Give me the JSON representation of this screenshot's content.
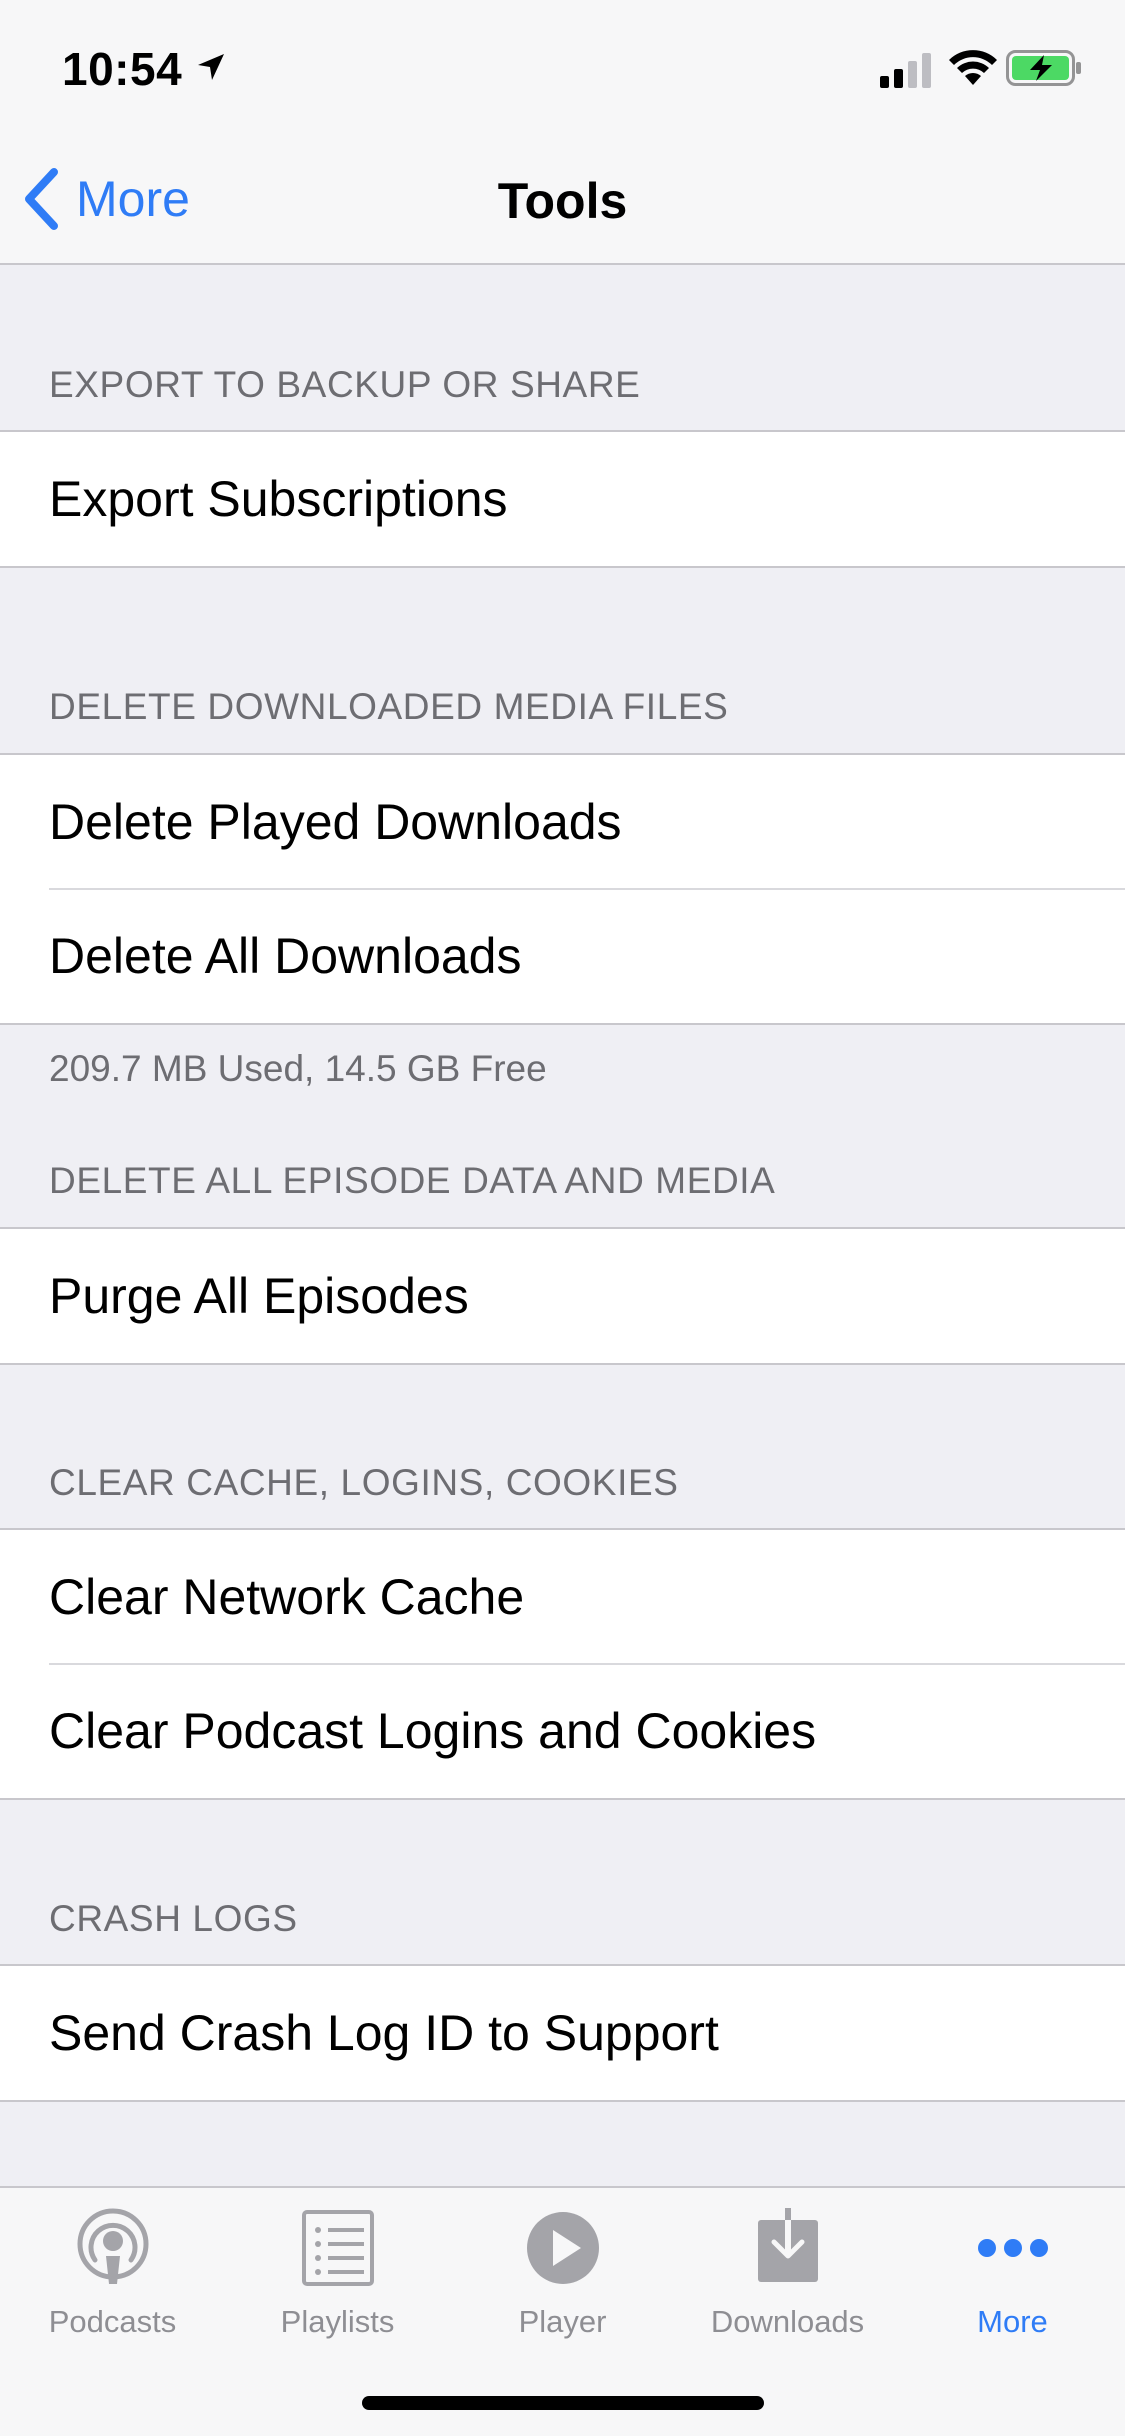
{
  "status_bar": {
    "time": "10:54"
  },
  "nav": {
    "back_label": "More",
    "title": "Tools"
  },
  "sections": [
    {
      "header": "EXPORT TO BACKUP OR SHARE",
      "rows": [
        "Export Subscriptions"
      ]
    },
    {
      "header": "DELETE DOWNLOADED MEDIA FILES",
      "rows": [
        "Delete Played Downloads",
        "Delete All Downloads"
      ],
      "footer": "209.7 MB Used, 14.5 GB Free"
    },
    {
      "header": "DELETE ALL EPISODE DATA AND MEDIA",
      "rows": [
        "Purge All Episodes"
      ]
    },
    {
      "header": "CLEAR CACHE, LOGINS, COOKIES",
      "rows": [
        "Clear Network Cache",
        "Clear Podcast Logins and Cookies"
      ]
    },
    {
      "header": "CRASH LOGS",
      "rows": [
        "Send Crash Log ID to Support"
      ]
    }
  ],
  "tab_bar": {
    "tabs": [
      {
        "label": "Podcasts",
        "icon": "podcasts-icon"
      },
      {
        "label": "Playlists",
        "icon": "playlist-icon"
      },
      {
        "label": "Player",
        "icon": "play-icon"
      },
      {
        "label": "Downloads",
        "icon": "download-icon"
      },
      {
        "label": "More",
        "icon": "more-icon"
      }
    ],
    "active": "More"
  },
  "colors": {
    "accent": "#2F7CF6",
    "background": "#EFEFF4",
    "secondary_text": "#6D6D72",
    "battery_green": "#4CD964"
  }
}
